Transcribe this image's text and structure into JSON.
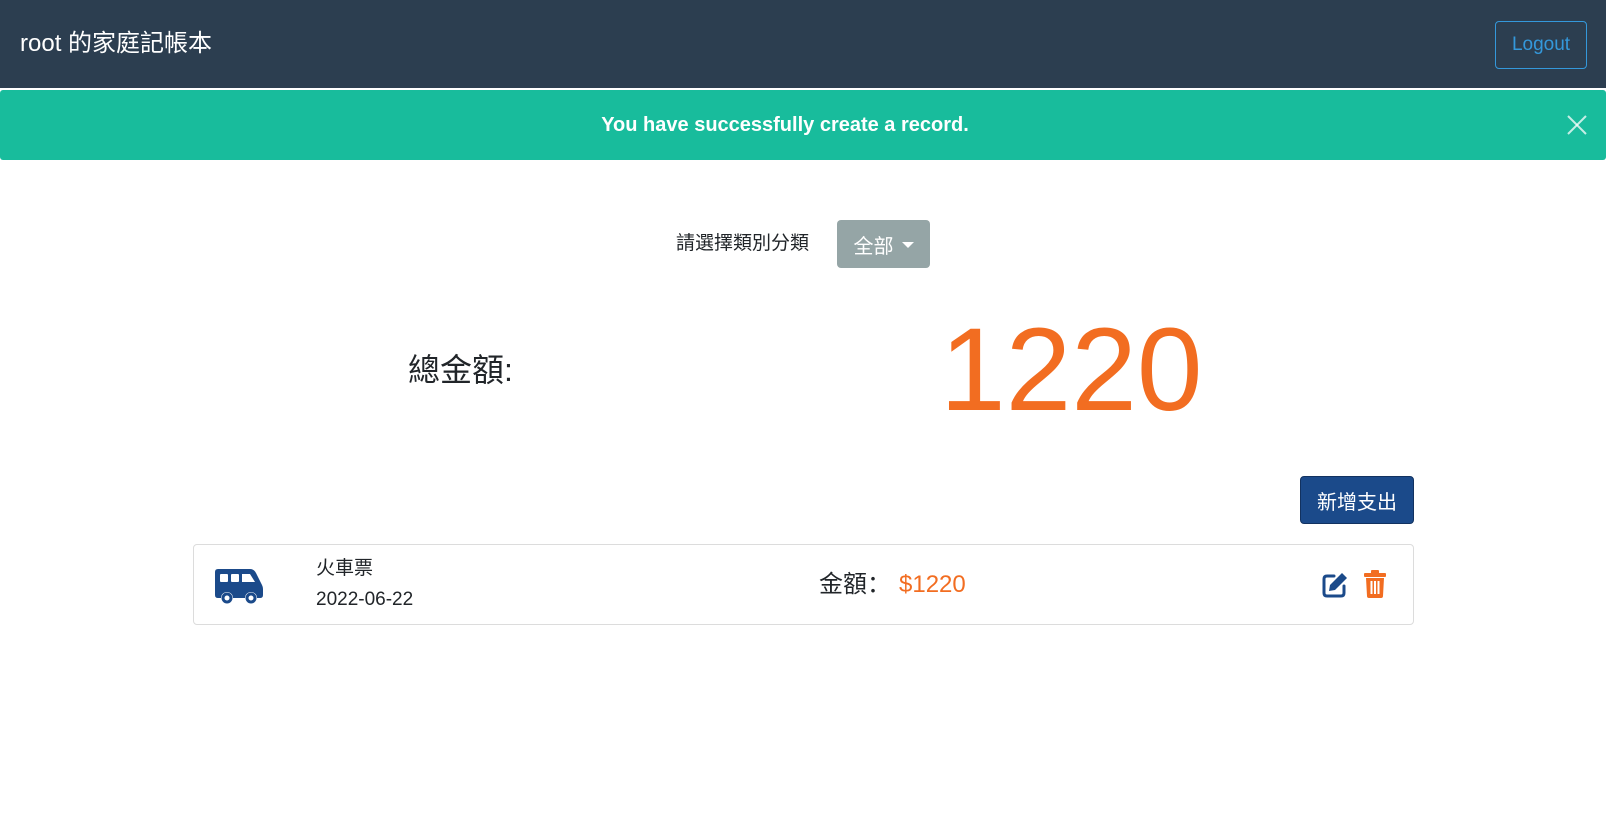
{
  "navbar": {
    "brand": "root 的家庭記帳本",
    "logout_label": "Logout"
  },
  "alert": {
    "message": "You have successfully create a record.",
    "close_icon": "close-icon"
  },
  "filter": {
    "label": "請選擇類別分類",
    "selected": "全部"
  },
  "total": {
    "label": "總金額:",
    "amount": "1220"
  },
  "actions": {
    "add_label": "新增支出"
  },
  "records": [
    {
      "icon": "shuttle-van-icon",
      "name": "火車票",
      "date": "2022-06-22",
      "amount_label": "金額：",
      "amount": "$1220"
    }
  ],
  "colors": {
    "navbar": "#2c3e50",
    "alert": "#18bc9c",
    "accent": "#f26d21",
    "primary": "#1b4a8a",
    "filter_button": "#95a5a6",
    "logout": "#3498db"
  }
}
